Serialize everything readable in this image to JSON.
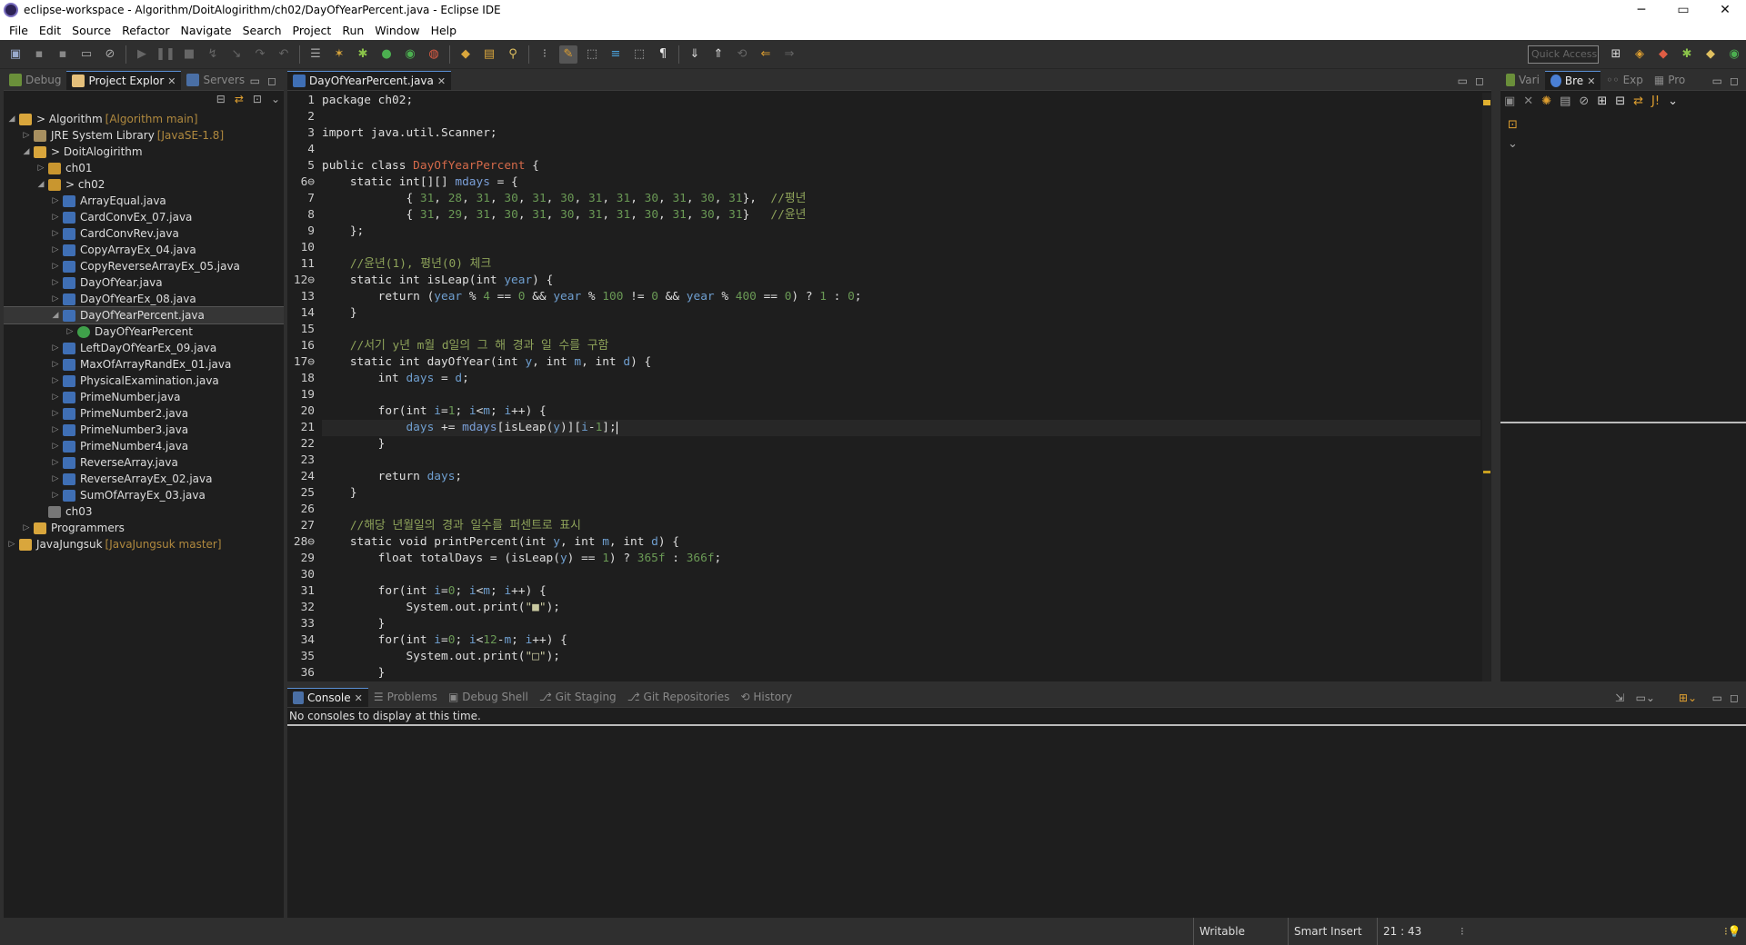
{
  "window": {
    "title": "eclipse-workspace - Algorithm/DoitAlogirithm/ch02/DayOfYearPercent.java - Eclipse IDE",
    "minimize": "─",
    "maximize": "▭",
    "close": "✕"
  },
  "menu": [
    "File",
    "Edit",
    "Source",
    "Refactor",
    "Navigate",
    "Search",
    "Project",
    "Run",
    "Window",
    "Help"
  ],
  "toolbar": {
    "quick_access": "Quick Access"
  },
  "left_tabs": [
    "Debug",
    "Project Explor",
    "Servers"
  ],
  "tree": [
    {
      "label": "> Algorithm",
      "deco": "[Algorithm main]"
    },
    {
      "label": "JRE System Library",
      "deco": "[JavaSE-1.8]"
    },
    {
      "label": "> DoitAlogirithm",
      "deco": ""
    },
    {
      "label": "ch01",
      "deco": ""
    },
    {
      "label": "> ch02",
      "deco": ""
    },
    {
      "label": "ArrayEqual.java",
      "deco": ""
    },
    {
      "label": "CardConvEx_07.java",
      "deco": ""
    },
    {
      "label": "CardConvRev.java",
      "deco": ""
    },
    {
      "label": "CopyArrayEx_04.java",
      "deco": ""
    },
    {
      "label": "CopyReverseArrayEx_05.java",
      "deco": ""
    },
    {
      "label": "DayOfYear.java",
      "deco": ""
    },
    {
      "label": "DayOfYearEx_08.java",
      "deco": ""
    },
    {
      "label": "DayOfYearPercent.java",
      "deco": ""
    },
    {
      "label": "DayOfYearPercent",
      "deco": ""
    },
    {
      "label": "LeftDayOfYearEx_09.java",
      "deco": ""
    },
    {
      "label": "MaxOfArrayRandEx_01.java",
      "deco": ""
    },
    {
      "label": "PhysicalExamination.java",
      "deco": ""
    },
    {
      "label": "PrimeNumber.java",
      "deco": ""
    },
    {
      "label": "PrimeNumber2.java",
      "deco": ""
    },
    {
      "label": "PrimeNumber3.java",
      "deco": ""
    },
    {
      "label": "PrimeNumber4.java",
      "deco": ""
    },
    {
      "label": "ReverseArray.java",
      "deco": ""
    },
    {
      "label": "ReverseArrayEx_02.java",
      "deco": ""
    },
    {
      "label": "SumOfArrayEx_03.java",
      "deco": ""
    },
    {
      "label": "ch03",
      "deco": ""
    },
    {
      "label": "Programmers",
      "deco": ""
    },
    {
      "label": "JavaJungsuk",
      "deco": "[JavaJungsuk master]"
    }
  ],
  "editor": {
    "tab": "DayOfYearPercent.java"
  },
  "code_lines": [
    "package ch02;",
    "",
    "import java.util.Scanner;",
    "",
    "public class DayOfYearPercent {",
    "    static int[][] mdays = {",
    "            { 31, 28, 31, 30, 31, 30, 31, 31, 30, 31, 30, 31},  //평년",
    "            { 31, 29, 31, 30, 31, 30, 31, 31, 30, 31, 30, 31}   //윤년",
    "    };",
    "",
    "    //윤년(1), 평년(0) 체크",
    "    static int isLeap(int year) {",
    "        return (year % 4 == 0 && year % 100 != 0 && year % 400 == 0) ? 1 : 0;",
    "    }",
    "",
    "    //서기 y년 m월 d일의 그 해 경과 일 수를 구함",
    "    static int dayOfYear(int y, int m, int d) {",
    "        int days = d;",
    "",
    "        for(int i=1; i<m; i++) {",
    "            days += mdays[isLeap(y)][i-1];",
    "        }",
    "",
    "        return days;",
    "    }",
    "",
    "    //해당 년월일의 경과 일수를 퍼센트로 표시",
    "    static void printPercent(int y, int m, int d) {",
    "        float totalDays = (isLeap(y) == 1) ? 365f : 366f;",
    "",
    "        for(int i=0; i<m; i++) {",
    "            System.out.print(\"■\");",
    "        }",
    "        for(int i=0; i<12-m; i++) {",
    "            System.out.print(\"□\");",
    "        }"
  ],
  "line_numbers": [
    "1",
    "2",
    "3",
    "4",
    "5",
    "6⊖",
    "7",
    "8",
    "9",
    "10",
    "11",
    "12⊖",
    "13",
    "14",
    "15",
    "16",
    "17⊖",
    "18",
    "19",
    "20",
    "21",
    "22",
    "23",
    "24",
    "25",
    "26",
    "27",
    "28⊖",
    "29",
    "30",
    "31",
    "32",
    "33",
    "34",
    "35",
    "36"
  ],
  "right_tabs": [
    "Vari",
    "Bre",
    "Exp",
    "Pro"
  ],
  "bottom_tabs": [
    "Console",
    "Problems",
    "Debug Shell",
    "Git Staging",
    "Git Repositories",
    "History"
  ],
  "console": {
    "message": "No consoles to display at this time."
  },
  "status": {
    "writable": "Writable",
    "insert_mode": "Smart Insert",
    "position": "21 : 43"
  }
}
